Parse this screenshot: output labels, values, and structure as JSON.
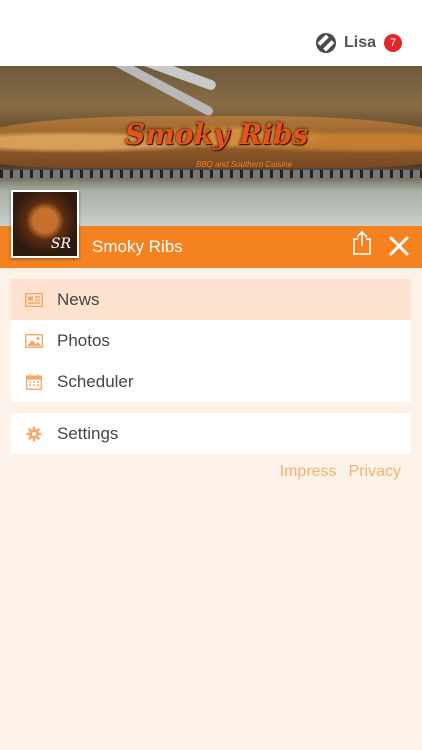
{
  "user": {
    "name": "Lisa",
    "badge": "7"
  },
  "banner": {
    "logo_text": "Smoky Ribs",
    "logo_subtitle": "BBQ and Southern Cuisine"
  },
  "header": {
    "shop_name": "Smoky Ribs",
    "thumb_initials": "SR"
  },
  "menu": [
    {
      "label": "News",
      "icon": "news-icon"
    },
    {
      "label": "Photos",
      "icon": "photo-icon"
    },
    {
      "label": "Scheduler",
      "icon": "calendar-icon"
    }
  ],
  "settings": {
    "label": "Settings",
    "icon": "gear-icon"
  },
  "footer": {
    "impress": "Impress",
    "privacy": "Privacy"
  },
  "colors": {
    "accent": "#f58220",
    "icon": "#f3a86a",
    "active_bg": "#fde3cf",
    "badge": "#e3262b"
  }
}
